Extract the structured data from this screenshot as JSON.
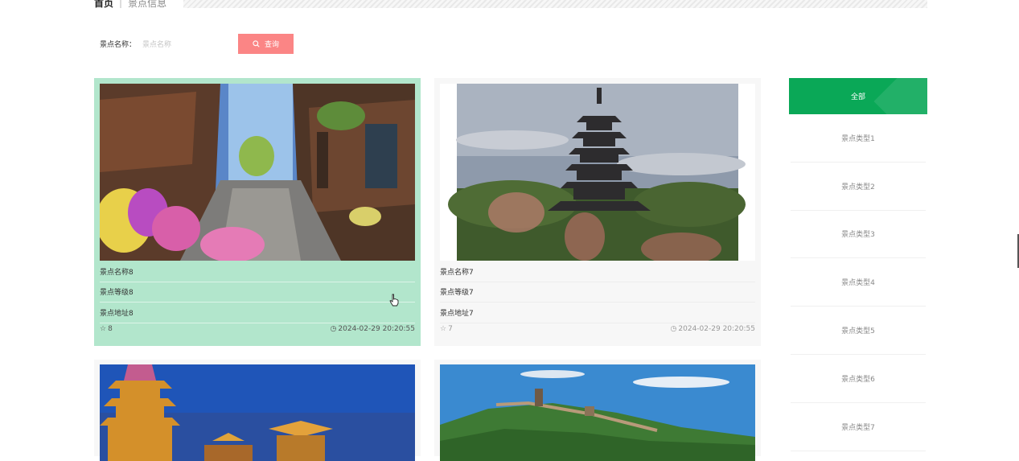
{
  "breadcrumb": {
    "home": "首页",
    "separator": "|",
    "current": "景点信息"
  },
  "search": {
    "label": "景点名称：",
    "placeholder": "景点名称",
    "value": "",
    "button_label": "查询"
  },
  "cards": [
    {
      "name": "景点名称8",
      "level": "景点等级8",
      "address": "景点地址8",
      "likes": "8",
      "time": "2024-02-29 20:20:55"
    },
    {
      "name": "景点名称7",
      "level": "景点等级7",
      "address": "景点地址7",
      "likes": "7",
      "time": "2024-02-29 20:20:55"
    }
  ],
  "sidebar": {
    "all_label": "全部",
    "items": [
      "景点类型1",
      "景点类型2",
      "景点类型3",
      "景点类型4",
      "景点类型5",
      "景点类型6",
      "景点类型7"
    ]
  },
  "colors": {
    "accent_green": "#0aa857",
    "search_button": "#fb8585",
    "card_hover": "#b2e6cc"
  }
}
